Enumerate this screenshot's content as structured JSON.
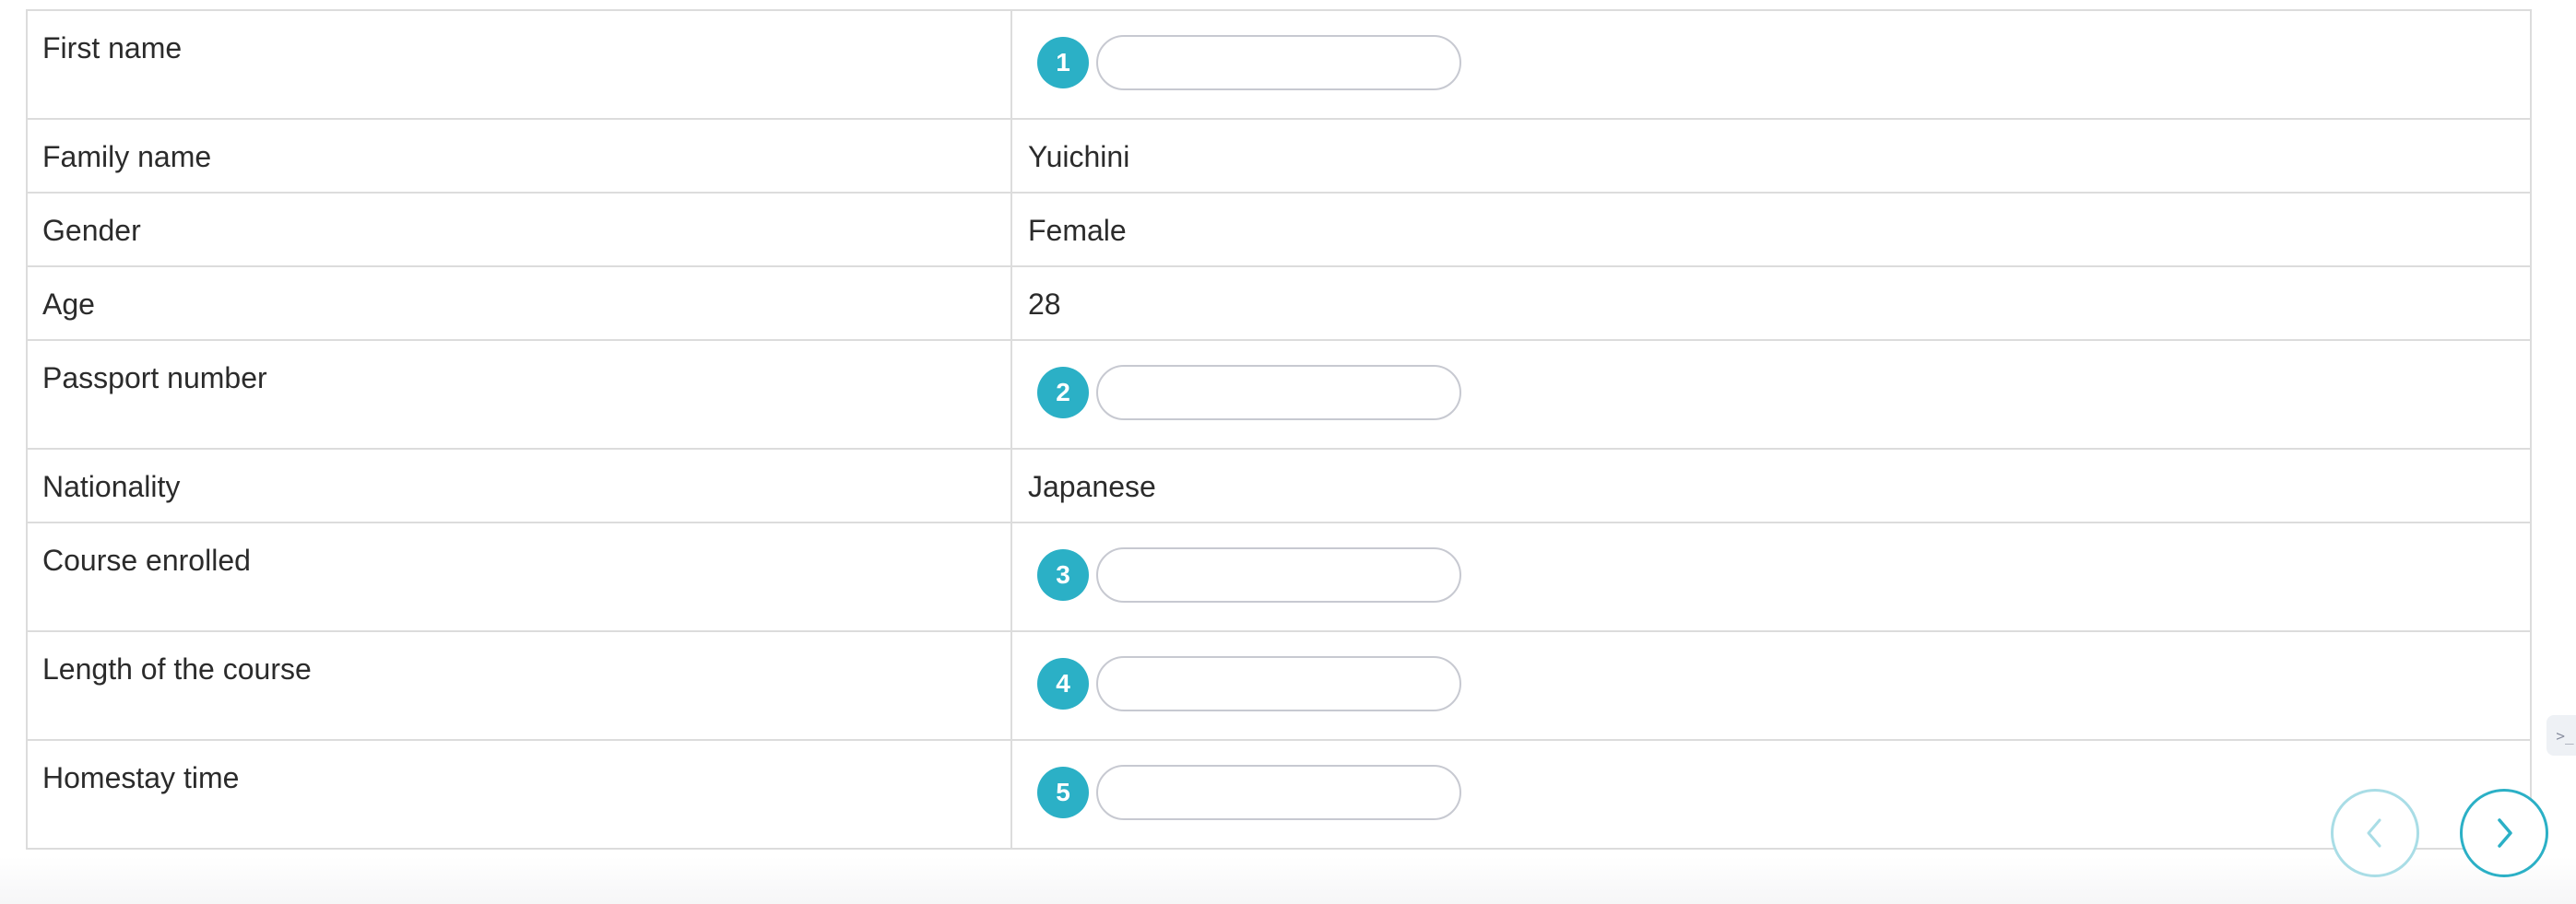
{
  "form": {
    "rows": [
      {
        "label": "First name",
        "type": "input",
        "number": "1",
        "value": ""
      },
      {
        "label": "Family name",
        "type": "text",
        "value": "Yuichini"
      },
      {
        "label": "Gender",
        "type": "text",
        "value": "Female"
      },
      {
        "label": "Age",
        "type": "text",
        "value": "28"
      },
      {
        "label": "Passport number",
        "type": "input",
        "number": "2",
        "value": ""
      },
      {
        "label": "Nationality",
        "type": "text",
        "value": "Japanese"
      },
      {
        "label": "Course enrolled",
        "type": "input",
        "number": "3",
        "value": ""
      },
      {
        "label": "Length of the course",
        "type": "input",
        "number": "4",
        "value": ""
      },
      {
        "label": "Homestay time",
        "type": "input",
        "number": "5",
        "value": ""
      }
    ]
  },
  "colors": {
    "accent": "#2bb0c6",
    "accent_light": "#a9dde6",
    "border": "#dcdcdc"
  },
  "nav": {
    "prev_icon": "chevron-left-icon",
    "next_icon": "chevron-right-icon"
  },
  "side_tab": {
    "icon": "terminal-icon",
    "glyph": ">_"
  }
}
